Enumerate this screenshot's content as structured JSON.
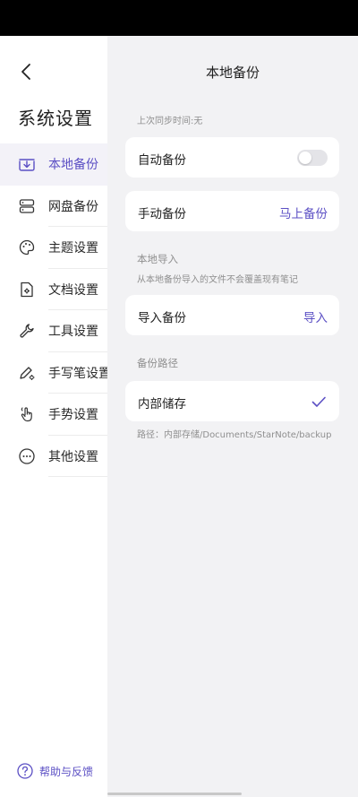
{
  "sidebar": {
    "title": "系统设置",
    "items": [
      {
        "label": "本地备份",
        "icon": "local-backup-icon"
      },
      {
        "label": "网盘备份",
        "icon": "cloud-drive-icon"
      },
      {
        "label": "主题设置",
        "icon": "palette-icon"
      },
      {
        "label": "文档设置",
        "icon": "document-settings-icon"
      },
      {
        "label": "工具设置",
        "icon": "wrench-icon"
      },
      {
        "label": "手写笔设置",
        "icon": "stylus-icon"
      },
      {
        "label": "手势设置",
        "icon": "gesture-icon"
      },
      {
        "label": "其他设置",
        "icon": "more-icon"
      }
    ],
    "active_index": 0,
    "help_label": "帮助与反馈"
  },
  "main": {
    "title": "本地备份",
    "last_sync": "上次同步时间:无",
    "auto_backup": {
      "label": "自动备份",
      "enabled": false
    },
    "manual_backup": {
      "label": "手动备份",
      "action": "马上备份"
    },
    "local_import": {
      "section": "本地导入",
      "note": "从本地备份导入的文件不会覆盖现有笔记",
      "label": "导入备份",
      "action": "导入"
    },
    "backup_path": {
      "section": "备份路径",
      "option": "内部储存",
      "selected": true,
      "path": "路径：内部存储/Documents/StarNote/backup"
    }
  },
  "colors": {
    "accent": "#5b4fc4",
    "status_bar": "#000000",
    "main_bg": "#f2f2f4",
    "active_bg": "#f3f2f8"
  }
}
